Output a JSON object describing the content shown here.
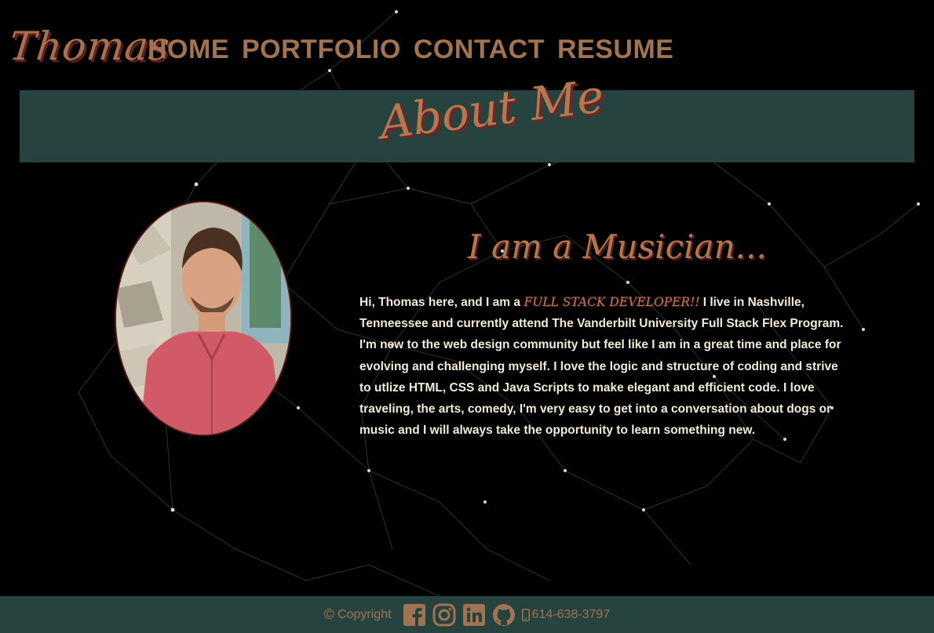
{
  "nav": {
    "brand": "Thomas",
    "links": [
      "HOME",
      "PORTFOLIO",
      "CONTACT",
      "RESUME"
    ]
  },
  "banner": {
    "title": "About Me"
  },
  "about": {
    "subtitle": "I am a Musician...",
    "bio_intro": "Hi, Thomas here, and I am a ",
    "bio_highlight": "FULL STACK DEVELOPER!!",
    "bio_rest": " I live in Nashville, Tenneessee and currently attend The Vanderbilt University Full Stack Flex Program. I'm new to the web design community but feel like I am in a great time and place for evolving and challenging myself. I love the logic and structure of coding and strive to utlize HTML, CSS and Java Scripts to make elegant and efficient code. I love traveling, the arts, comedy, I'm very easy to get into a conversation about dogs or music and I will always take the opportunity to learn something new."
  },
  "footer": {
    "copyright_symbol": "©",
    "copyright_label": "Copyright",
    "social_icons": [
      "facebook-icon",
      "instagram-icon",
      "linkedin-icon",
      "github-icon"
    ],
    "phone": "614-638-3797"
  },
  "colors": {
    "accent": "#a27350",
    "banner_bg": "#274340",
    "text_light": "#f1ebd8",
    "shadow": "#6b1d1d"
  }
}
